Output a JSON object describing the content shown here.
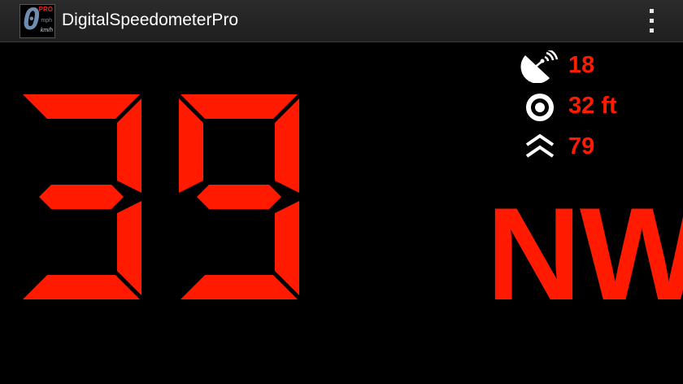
{
  "app": {
    "title": "DigitalSpeedometerPro",
    "icon": {
      "digit": "0",
      "badge": "PRO",
      "unit_top": "mph",
      "unit_bottom": "km/h"
    }
  },
  "menu": {
    "icon": "overflow-menu-icon"
  },
  "speed": {
    "value": "39",
    "digits": [
      "3",
      "9"
    ],
    "color": "#ff1a00"
  },
  "status": {
    "satellites": {
      "icon": "satellite-dish-icon",
      "value": "18"
    },
    "accuracy": {
      "icon": "target-icon",
      "value": "32 ft"
    },
    "altitude": {
      "icon": "altitude-chevron-icon",
      "value": "79"
    }
  },
  "heading": {
    "value": "NW"
  },
  "colors": {
    "accent": "#ff1a00",
    "background": "#000000",
    "action_bar": "#252525"
  }
}
